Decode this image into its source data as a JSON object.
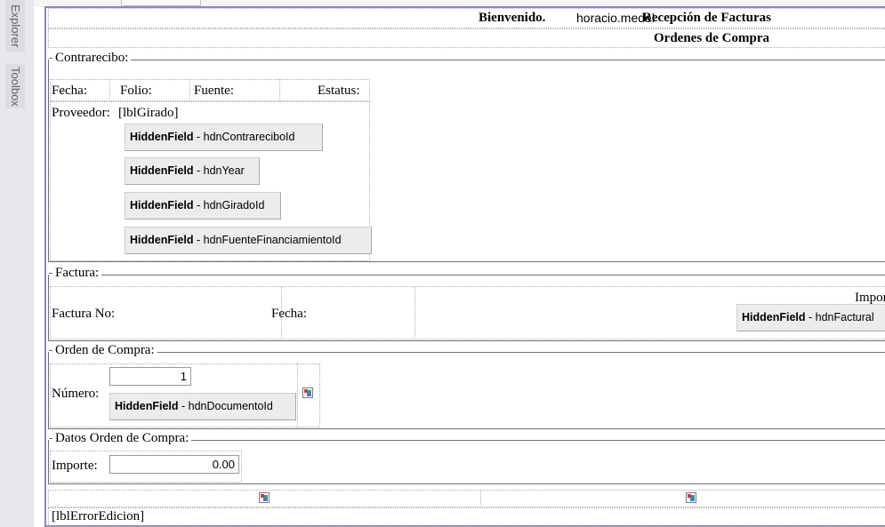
{
  "sidebar": {
    "explorer_tab": "Explorer",
    "toolbox_tab": "Toolbox"
  },
  "header": {
    "welcome": "Bienvenido.",
    "user": "horacio.medel",
    "title": "Recepción de Facturas",
    "subtitle": "Ordenes de Compra"
  },
  "contrarecibo": {
    "legend": "Contrarecibo:",
    "fecha_label": "Fecha:",
    "folio_label": "Folio:",
    "fuente_label": "Fuente:",
    "estatus_label": "Estatus:",
    "proveedor_label": "Proveedor:",
    "proveedor_value": "[lblGirado]",
    "hidden_fields": [
      {
        "type": "HiddenField",
        "name": " - hdnContrareciboId"
      },
      {
        "type": "HiddenField",
        "name": " - hdnYear"
      },
      {
        "type": "HiddenField",
        "name": " - hdnGiradoId"
      },
      {
        "type": "HiddenField",
        "name": " - hdnFuenteFinanciamientoId"
      }
    ]
  },
  "factura": {
    "legend": "Factura:",
    "numero_label": "Factura No:",
    "fecha_label": "Fecha:",
    "importe_label": "Impor",
    "hidden_field": {
      "type": "HiddenField",
      "name": " - hdnFactural"
    }
  },
  "orden": {
    "legend": "Orden de Compra:",
    "numero_label": "Número:",
    "numero_value": "1",
    "hidden_field": {
      "type": "HiddenField",
      "name": " - hdnDocumentoId"
    }
  },
  "datos_orden": {
    "legend": "Datos Orden de Compra:",
    "importe_label": "Importe:",
    "importe_value": "0.00"
  },
  "footer": {
    "error_label": "[lblErrorEdicion]"
  }
}
